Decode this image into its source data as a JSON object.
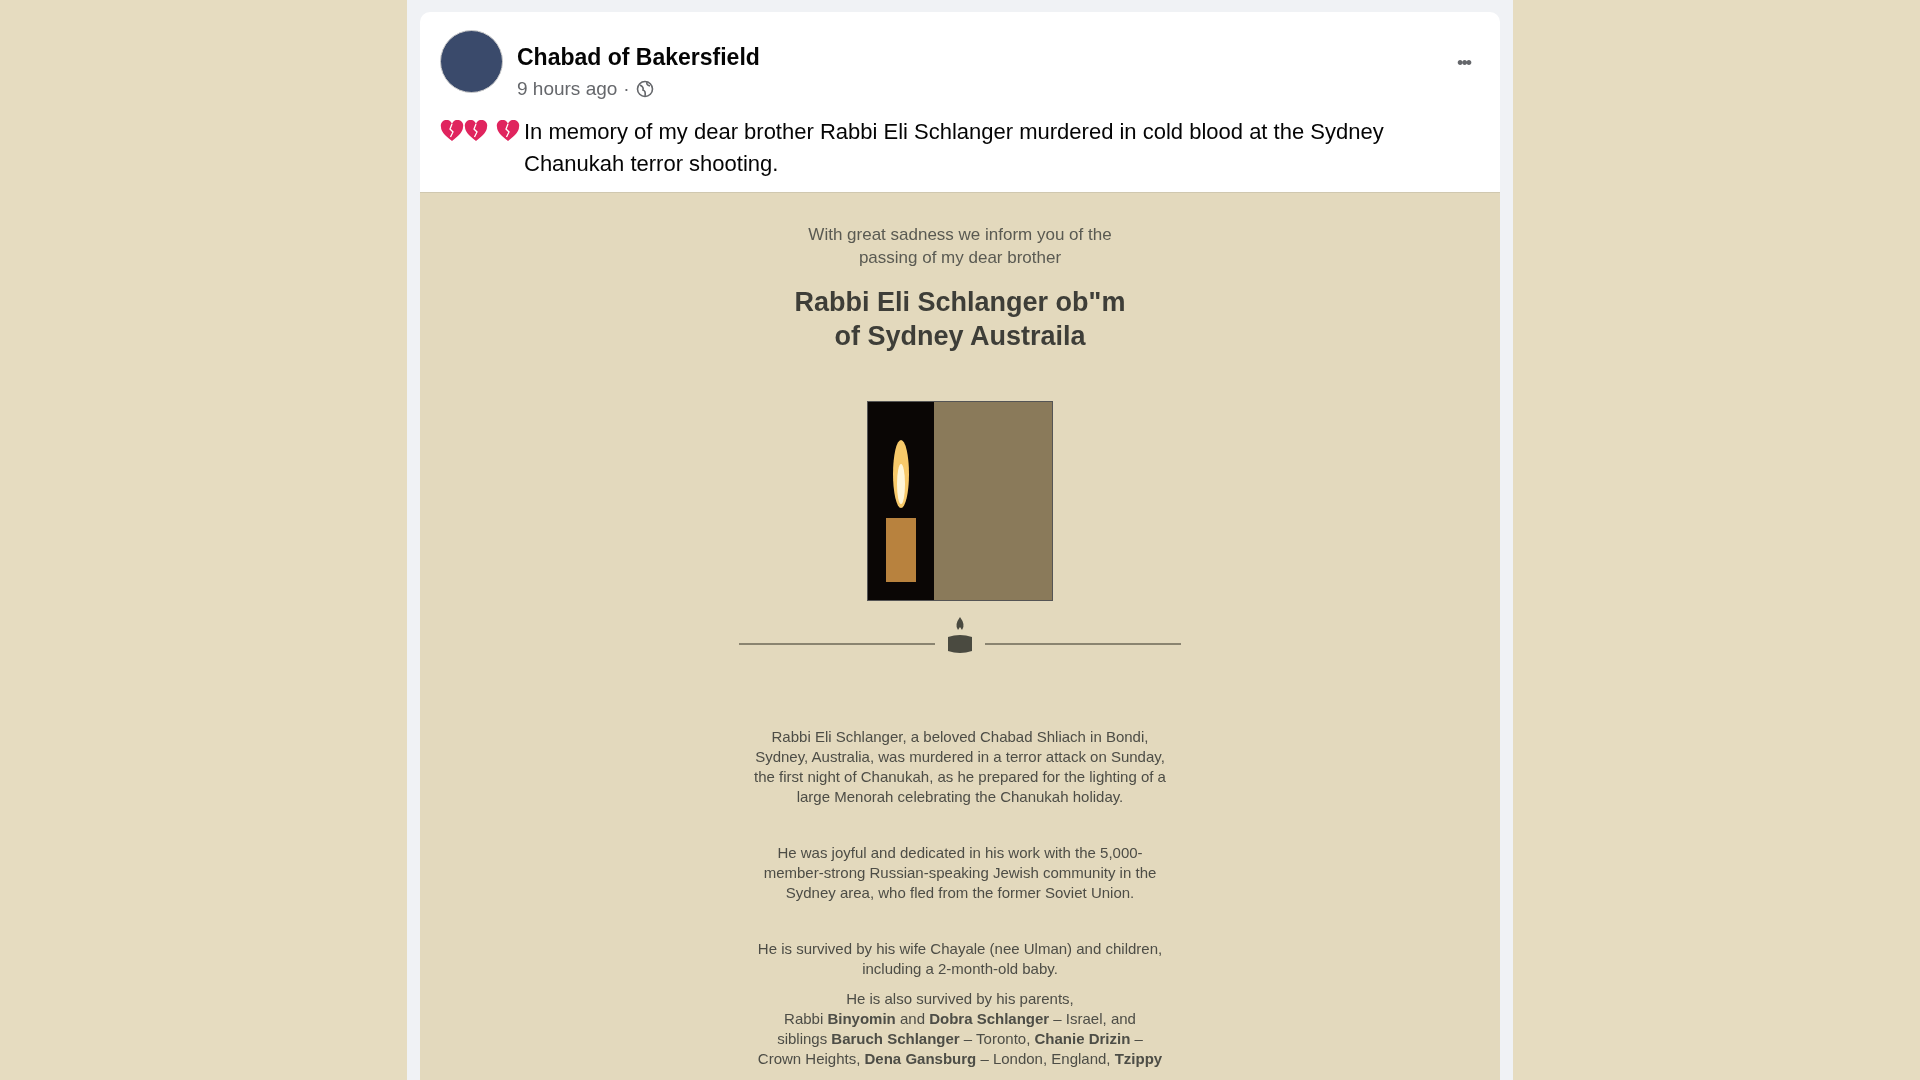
{
  "post": {
    "author": "Chabad of Bakersfield",
    "time": "9 hours ago",
    "separator": "·",
    "menu": "•••",
    "text": "In memory of my dear brother Rabbi Eli Schlanger murdered in cold blood at the Sydney Chanukah terror shooting."
  },
  "notice": {
    "intro": [
      "With great sadness we inform you of the",
      "passing of my dear brother"
    ],
    "title": [
      "Rabbi Eli Schlanger ob\"m",
      "of Sydney Austraila"
    ],
    "paragraphs": [
      [
        "Rabbi Eli Schlanger, a beloved Chabad Shliach in Bondi,",
        "Sydney, Australia, was murdered in a terror attack on Sunday,",
        "the first night of Chanukah, as he prepared for the lighting of a",
        "large Menorah celebrating the Chanukah holiday."
      ],
      [
        "He was joyful and dedicated in his work with the 5,000-",
        "member-strong Russian-speaking Jewish community in the",
        "Sydney area, who fled from the former Soviet Union."
      ],
      [
        "He is survived by his wife Chayale (nee Ulman) and children,",
        "including a 2-month-old baby."
      ],
      [
        "He is also survived by his parents,",
        "Rabbi **Binyomin** and **Dobra Schlanger** – Israel, and",
        "siblings **Baruch Schlanger** – Toronto, **Chanie Drizin** –",
        "Crown Heights, **Dena Gansburg** – London, England, **Tzippy**"
      ]
    ]
  }
}
